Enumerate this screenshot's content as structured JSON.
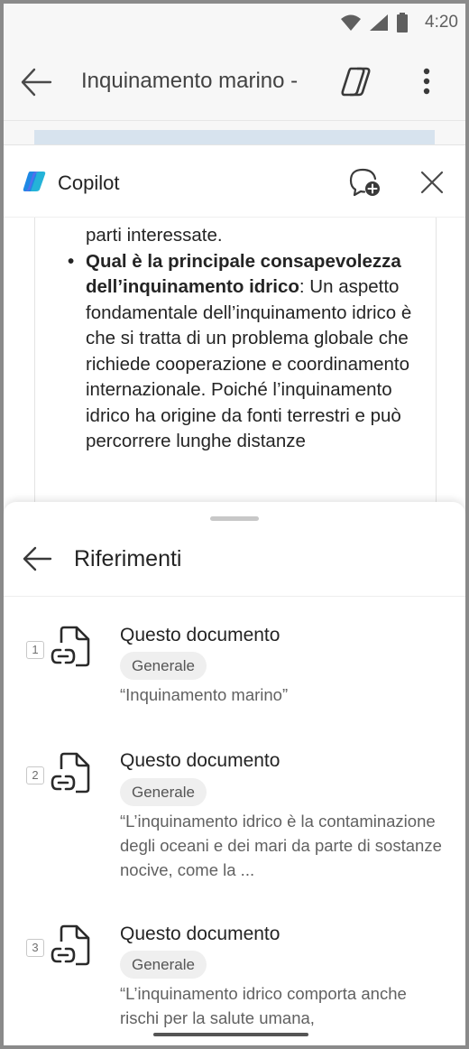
{
  "status_bar": {
    "time": "4:20"
  },
  "app_bar": {
    "title": "Inquinamento marino -"
  },
  "copilot": {
    "title": "Copilot",
    "previous_line": "parti interessate.",
    "bullet": {
      "bold": "Qual è la principale consapevolezza dell’inquinamento idrico",
      "text": ": Un aspetto fondamentale dell’inquinamento idrico è che si tratta di un problema globale che richiede cooperazione e coordinamento internazionale. Poiché l’inquinamento idrico ha origine da fonti terrestri e può percorrere lunghe distanze"
    }
  },
  "references": {
    "title": "Riferimenti",
    "items": [
      {
        "number": "1",
        "title": "Questo documento",
        "tag": "Generale",
        "quote": "“Inquinamento marino”"
      },
      {
        "number": "2",
        "title": "Questo documento",
        "tag": "Generale",
        "quote": "“L’inquinamento idrico è la contaminazione degli oceani e dei mari da parte di sostanze nocive, come la ..."
      },
      {
        "number": "3",
        "title": "Questo documento",
        "tag": "Generale",
        "quote": "“L’inquinamento idrico comporta anche rischi per la salute umana,"
      }
    ]
  },
  "colors": {
    "accent_blue": "#1e88e5",
    "copilot_teal": "#25b3d8"
  }
}
